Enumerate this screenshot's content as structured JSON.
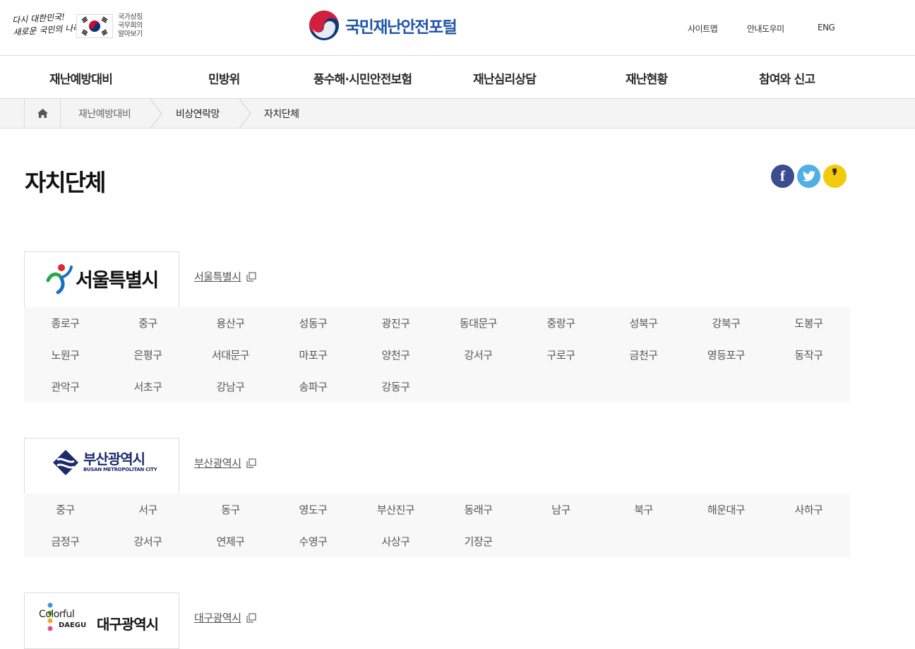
{
  "header": {
    "slogan_line1": "다시 대한민국!",
    "slogan_line2": "새로운 국민의 나라",
    "symbol_link": "국가상징\n국무회의\n알아보기",
    "portal_name": "국민재난안전포털",
    "util": {
      "sitemap": "사이트맵",
      "guide": "안내도우미",
      "eng": "ENG"
    },
    "brand_color": "#2156a8"
  },
  "gnb": [
    "재난예방대비",
    "민방위",
    "풍수해·시민안전보험",
    "재난심리상담",
    "재난현황",
    "참여와 신고"
  ],
  "breadcrumb": {
    "home_icon": "home-icon",
    "items": [
      "재난예방대비",
      "비상연락망",
      "자치단체"
    ]
  },
  "page": {
    "title": "자치단체"
  },
  "share": {
    "facebook": "f",
    "twitter": "twitter-icon",
    "kakao": "❜"
  },
  "regions": [
    {
      "logo_text": "서울특별시",
      "link": "서울특별시",
      "districts": [
        "종로구",
        "중구",
        "용산구",
        "성동구",
        "광진구",
        "동대문구",
        "중랑구",
        "성북구",
        "강북구",
        "도봉구",
        "노원구",
        "은평구",
        "서대문구",
        "마포구",
        "양천구",
        "강서구",
        "구로구",
        "금천구",
        "영등포구",
        "동작구",
        "관악구",
        "서초구",
        "강남구",
        "송파구",
        "강동구"
      ]
    },
    {
      "logo_text": "부산광역시",
      "logo_sub": "BUSAN METROPOLITAN CITY",
      "link": "부산광역시",
      "districts": [
        "중구",
        "서구",
        "동구",
        "영도구",
        "부산진구",
        "동래구",
        "남구",
        "북구",
        "해운대구",
        "사하구",
        "금정구",
        "강서구",
        "연제구",
        "수영구",
        "사상구",
        "기장군"
      ]
    },
    {
      "logo_text_1": "Colorful",
      "logo_text_2": "DAEGU",
      "logo_text_3": "대구광역시",
      "link": "대구광역시"
    }
  ]
}
